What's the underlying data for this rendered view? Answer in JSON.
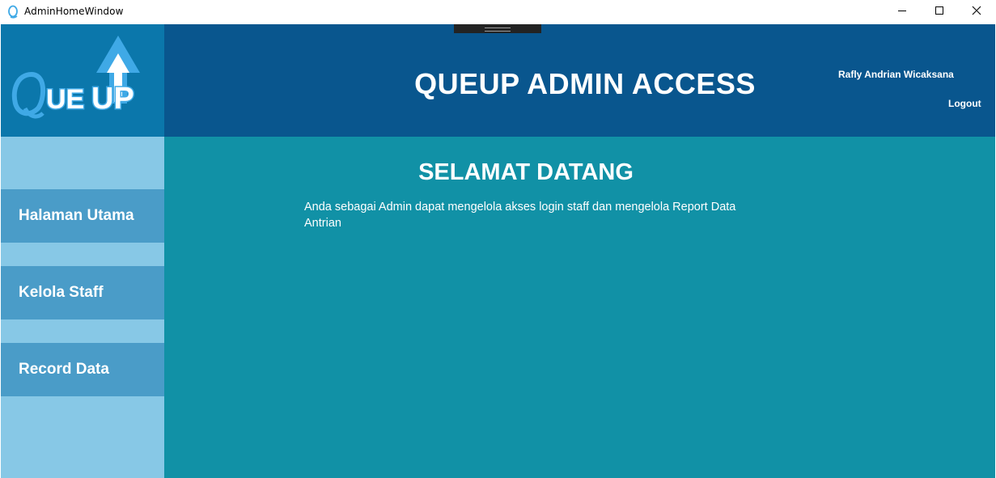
{
  "window": {
    "title": "AdminHomeWindow",
    "minimize_icon": "minimize-icon",
    "maximize_icon": "maximize-icon",
    "close_icon": "close-icon"
  },
  "logo": {
    "text": "QUEUP",
    "colors": {
      "outline": "#3fa9e6",
      "fill": "#ffffff"
    }
  },
  "header": {
    "title": "QUEUP ADMIN ACCESS",
    "user_name": "Rafly Andrian Wicaksana",
    "logout_label": "Logout"
  },
  "sidebar": {
    "items": [
      {
        "label": "Halaman Utama"
      },
      {
        "label": "Kelola Staff"
      },
      {
        "label": "Record Data"
      }
    ]
  },
  "main": {
    "title": "SELAMAT DATANG",
    "message": "Anda sebagai Admin dapat mengelola akses login staff dan mengelola Report Data Antrian"
  },
  "colors": {
    "logo_bg": "#0b77ab",
    "header_bg": "#09568e",
    "sidebar_bg": "#87c8e6",
    "nav_item_bg": "#4a9cc8",
    "main_bg": "#1191a6",
    "text": "#ffffff"
  }
}
